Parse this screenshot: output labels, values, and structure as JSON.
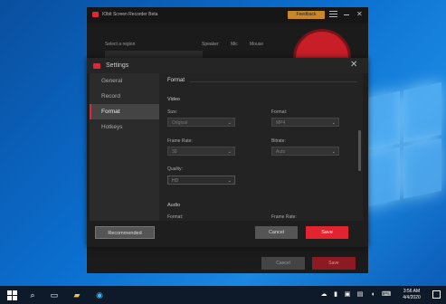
{
  "app": {
    "title": "IObit Screen Recorder Beta",
    "feedback_label": "Feedback",
    "region_label": "Select a region",
    "sources": [
      "Speaker",
      "Mic",
      "Mouse"
    ],
    "cancel_label": "Cancel",
    "save_label": "Save",
    "record_color": "#c81e28"
  },
  "dialog": {
    "title": "Settings",
    "nav": [
      {
        "label": "General"
      },
      {
        "label": "Record"
      },
      {
        "label": "Format"
      },
      {
        "label": "Hotkeys"
      }
    ],
    "active_nav": "Format",
    "section": "Format",
    "video": {
      "heading": "Video",
      "size_label": "Size:",
      "size_value": "Original",
      "format_label": "Format:",
      "format_value": "MP4",
      "framerate_label": "Frame Rate:",
      "framerate_value": "30",
      "bitrate_label": "Bitrate:",
      "bitrate_value": "Auto",
      "quality_label": "Quality:",
      "quality_value": "HD"
    },
    "audio": {
      "heading": "Audio",
      "format_label": "Format:",
      "framerate_label": "Frame Rate:"
    },
    "recommended_label": "Recommended",
    "cancel_label": "Cancel",
    "save_label": "Save",
    "accent_color": "#e1242f"
  },
  "taskbar": {
    "icons": [
      "windows-start-icon",
      "search-icon",
      "task-view-icon",
      "file-explorer-icon",
      "edge-icon"
    ],
    "tray_icons": [
      "cloud-icon",
      "usb-icon",
      "camera-icon",
      "network-icon",
      "volume-icon",
      "keyboard-icon"
    ],
    "time": "3:56 AM",
    "date": "4/4/2020"
  }
}
